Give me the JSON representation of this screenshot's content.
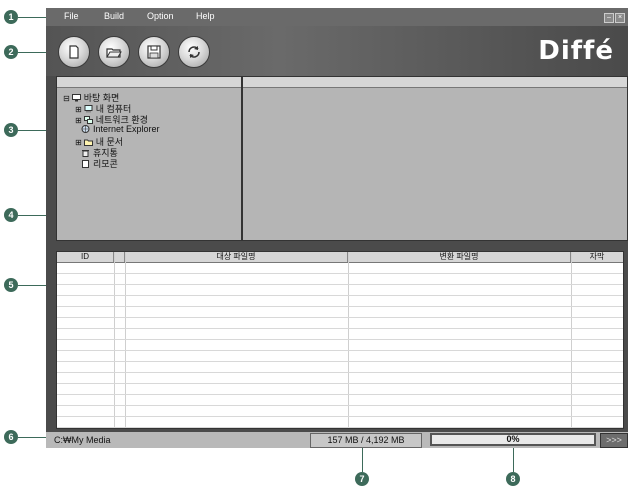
{
  "menu": [
    "File",
    "Build",
    "Option",
    "Help"
  ],
  "window_buttons": {
    "minimize": "–",
    "close": "×"
  },
  "toolbar": {
    "buttons": [
      "new",
      "open",
      "save",
      "convert"
    ],
    "logo": "Diffé"
  },
  "tree": {
    "items": [
      {
        "label": "바탕 화면",
        "expander": "⊟",
        "icon": "desktop-icon"
      },
      {
        "label": "내 컴퓨터",
        "expander": "⊞",
        "icon": "computer-icon"
      },
      {
        "label": "네트워크 환경",
        "expander": "⊞",
        "icon": "network-icon"
      },
      {
        "label": "Internet Explorer",
        "expander": "",
        "icon": "globe-icon"
      },
      {
        "label": "내 문서",
        "expander": "⊞",
        "icon": "folder-icon"
      },
      {
        "label": "휴지통",
        "expander": "",
        "icon": "trash-icon"
      },
      {
        "label": "리모콘",
        "expander": "",
        "icon": "file-icon"
      }
    ]
  },
  "table": {
    "headers": [
      "ID",
      "",
      "대상 파일명",
      "변환 파일명",
      "자막"
    ],
    "empty_rows": 15
  },
  "status": {
    "path": "C:₩My Media",
    "size": "157 MB / 4,192 MB",
    "progress": 0,
    "progress_label": "0%",
    "go_label": ">>>"
  },
  "callouts": [
    "1",
    "2",
    "3",
    "4",
    "5",
    "6",
    "7",
    "8"
  ],
  "colors": {
    "callout": "#3d6a5a",
    "frame": "#4b4b4b",
    "pane": "#b5b5b5",
    "progress": "#3b6b9b"
  }
}
